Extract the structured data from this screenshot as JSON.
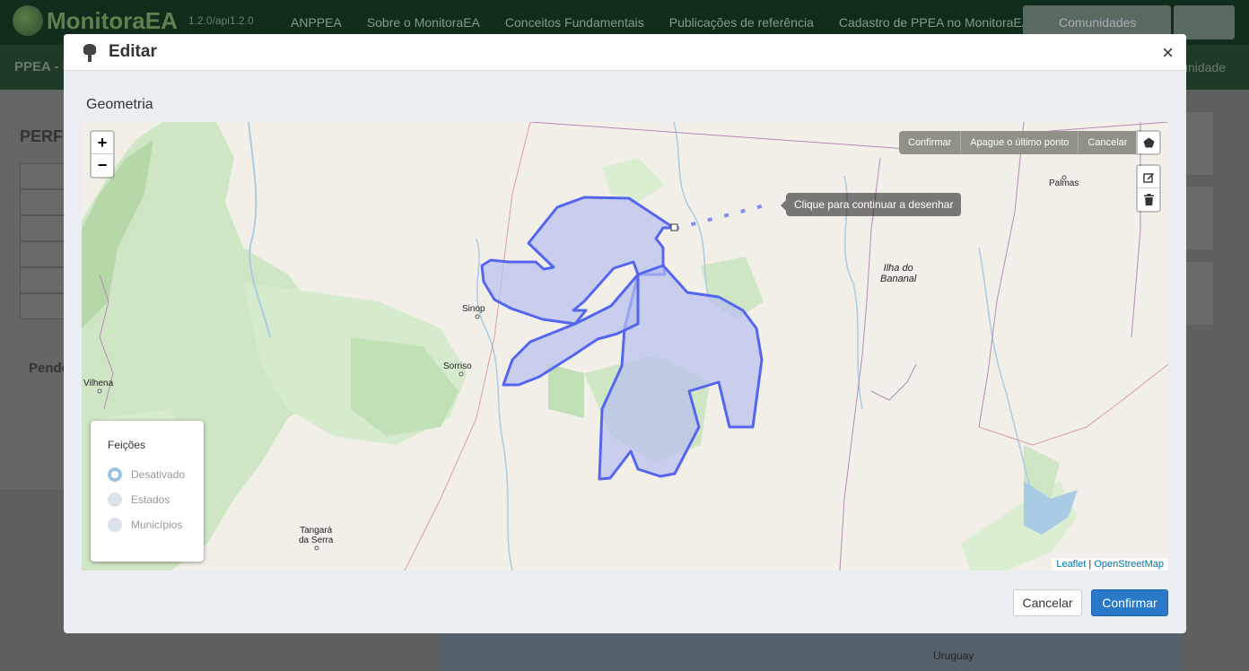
{
  "app": {
    "brand": "MonitoraEA",
    "version": "1.2.0/api1.2.0",
    "nav": [
      "ANPPEA",
      "Sobre o MonitoraEA",
      "Conceitos Fundamentais",
      "Publicações de referência",
      "Cadastro de PPEA no MonitoraEA"
    ],
    "communities_label": "Comunidades",
    "subbar_title": "PPEA - I",
    "subbar_right": "unidade",
    "profile_title": "PERFI",
    "pending_title": "Pendê",
    "bg_place": "Uruguay"
  },
  "modal": {
    "title": "Editar",
    "close": "×",
    "geometry_label": "Geometria",
    "cancel_label": "Cancelar",
    "confirm_label": "Confirmar"
  },
  "map": {
    "zoom_in": "+",
    "zoom_out": "−",
    "draw_actions": {
      "confirm": "Confirmar",
      "delete_last": "Apague o último ponto",
      "cancel": "Cancelar"
    },
    "tooltip": "Clique para continuar a desenhar",
    "places": {
      "sinop": "Sinop",
      "sorriso": "Sorriso",
      "vilhena": "Vilhena",
      "tangara_1": "Tangará",
      "tangara_2": "da Serra",
      "palmas": "Palmas",
      "ilha_1": "Ilha do",
      "ilha_2": "Bananal"
    },
    "layers_panel": {
      "title": "Feições",
      "options": [
        "Desativado",
        "Estados",
        "Municípios"
      ],
      "selected": "Desativado"
    },
    "attribution": {
      "leaflet": "Leaflet",
      "sep": "|",
      "osm": "OpenStreetMap"
    },
    "polygon_color": "#5566ee",
    "polygon_fill": "#b8bff0"
  }
}
